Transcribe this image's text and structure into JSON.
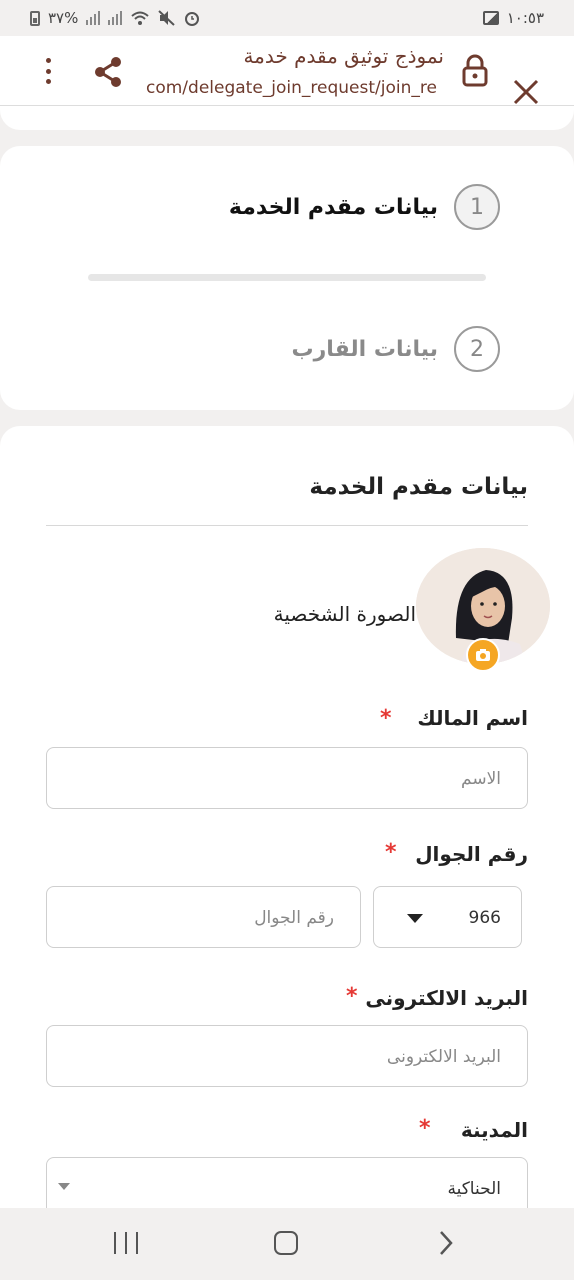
{
  "status_bar": {
    "time": "١٠:٥٣",
    "battery": "٣٧%"
  },
  "browser": {
    "title": "نموذج توثيق مقدم خدمة",
    "url": "com/delegate_join_request/join_re",
    "icons": {
      "close": "close-icon",
      "lock": "lock-icon",
      "share": "share-icon",
      "more": "more-vertical-icon"
    }
  },
  "steps": [
    {
      "number": "1",
      "label": "بيانات مقدم الخدمة"
    },
    {
      "number": "2",
      "label": "بيانات القارب"
    }
  ],
  "form": {
    "title": "بيانات مقدم الخدمة",
    "avatar_label": "الصورة الشخصية",
    "required_mark": "*",
    "owner_name": {
      "label": "اسم المالك",
      "placeholder": "الاسم"
    },
    "mobile": {
      "label": "رقم الجوال",
      "country_code": "966",
      "placeholder": "رقم الجوال"
    },
    "email": {
      "label": "البريد الالكترونى",
      "placeholder": "البريد الالكترونى"
    },
    "city": {
      "label": "المدينة",
      "value": "الحناكية"
    }
  },
  "colors": {
    "accent": "#6e3b2e",
    "required": "#e53935",
    "camera_badge": "#f5a623"
  }
}
